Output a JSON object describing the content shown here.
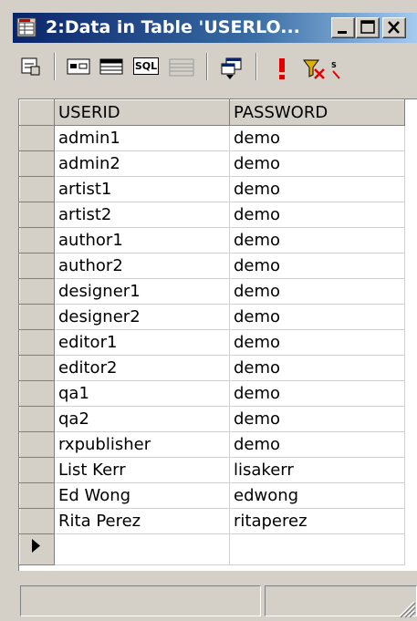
{
  "window": {
    "title": "2:Data in Table 'USERLO...",
    "minimize_icon": "minimize-icon",
    "maximize_icon": "maximize-icon",
    "close_icon": "close-icon"
  },
  "toolbar": {
    "icons": [
      "properties-icon",
      "form-view-icon",
      "grid-view-icon",
      "sql-icon",
      "disabled-view-icon",
      "insert-row-icon",
      "execute-icon",
      "filter-icon",
      "sql-overflow-icon"
    ],
    "sql_label": "SQL"
  },
  "grid": {
    "columns": [
      "USERID",
      "PASSWORD"
    ],
    "rows": [
      [
        "admin1",
        "demo"
      ],
      [
        "admin2",
        "demo"
      ],
      [
        "artist1",
        "demo"
      ],
      [
        "artist2",
        "demo"
      ],
      [
        "author1",
        "demo"
      ],
      [
        "author2",
        "demo"
      ],
      [
        "designer1",
        "demo"
      ],
      [
        "designer2",
        "demo"
      ],
      [
        "editor1",
        "demo"
      ],
      [
        "editor2",
        "demo"
      ],
      [
        "qa1",
        "demo"
      ],
      [
        "qa2",
        "demo"
      ],
      [
        "rxpublisher",
        "demo"
      ],
      [
        "List Kerr",
        "lisakerr"
      ],
      [
        "Ed Wong",
        "edwong"
      ],
      [
        "Rita Perez",
        "ritaperez"
      ]
    ],
    "new_row_indicator_icon": "current-row-arrow-icon"
  },
  "colors": {
    "titlebar_start": "#0a246a",
    "titlebar_end": "#a6caf0",
    "face": "#d4d0c8"
  }
}
